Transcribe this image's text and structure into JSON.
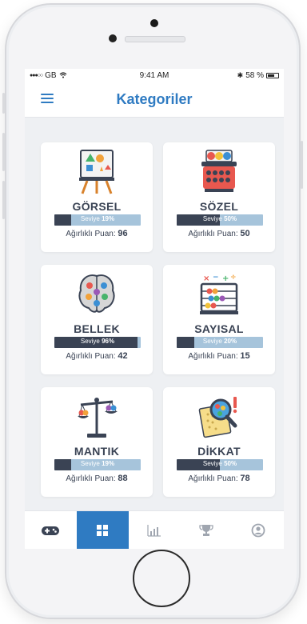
{
  "status": {
    "carrier": "GB",
    "time": "9:41 AM",
    "battery": "58 %"
  },
  "header": {
    "title": "Kategoriler"
  },
  "colors": {
    "accent": "#2f7bc2",
    "dark": "#3a4354",
    "bar_bg": "#a6c4db"
  },
  "categories": [
    {
      "name": "GÖRSEL",
      "level_label": "Seviye",
      "level": "19%",
      "level_value": 0.19,
      "score_label": "Ağırlıklı Puan:",
      "score": "96"
    },
    {
      "name": "SÖZEL",
      "level_label": "Seviye",
      "level": "50%",
      "level_value": 0.5,
      "score_label": "Ağırlıklı Puan:",
      "score": "50"
    },
    {
      "name": "BELLEK",
      "level_label": "Seviye",
      "level": "96%",
      "level_value": 0.96,
      "score_label": "Ağırlıklı Puan:",
      "score": "42"
    },
    {
      "name": "SAYISAL",
      "level_label": "Seviye",
      "level": "20%",
      "level_value": 0.2,
      "score_label": "Ağırlıklı Puan:",
      "score": "15"
    },
    {
      "name": "MANTIK",
      "level_label": "Seviye",
      "level": "19%",
      "level_value": 0.19,
      "score_label": "Ağırlıklı Puan:",
      "score": "88"
    },
    {
      "name": "DİKKAT",
      "level_label": "Seviye",
      "level": "50%",
      "level_value": 0.5,
      "score_label": "Ağırlıklı Puan:",
      "score": "78"
    }
  ],
  "tabs": [
    {
      "icon": "gamepad-icon",
      "active": false
    },
    {
      "icon": "grid-icon",
      "active": true
    },
    {
      "icon": "bar-chart-icon",
      "active": false
    },
    {
      "icon": "trophy-icon",
      "active": false
    },
    {
      "icon": "user-icon",
      "active": false
    }
  ]
}
